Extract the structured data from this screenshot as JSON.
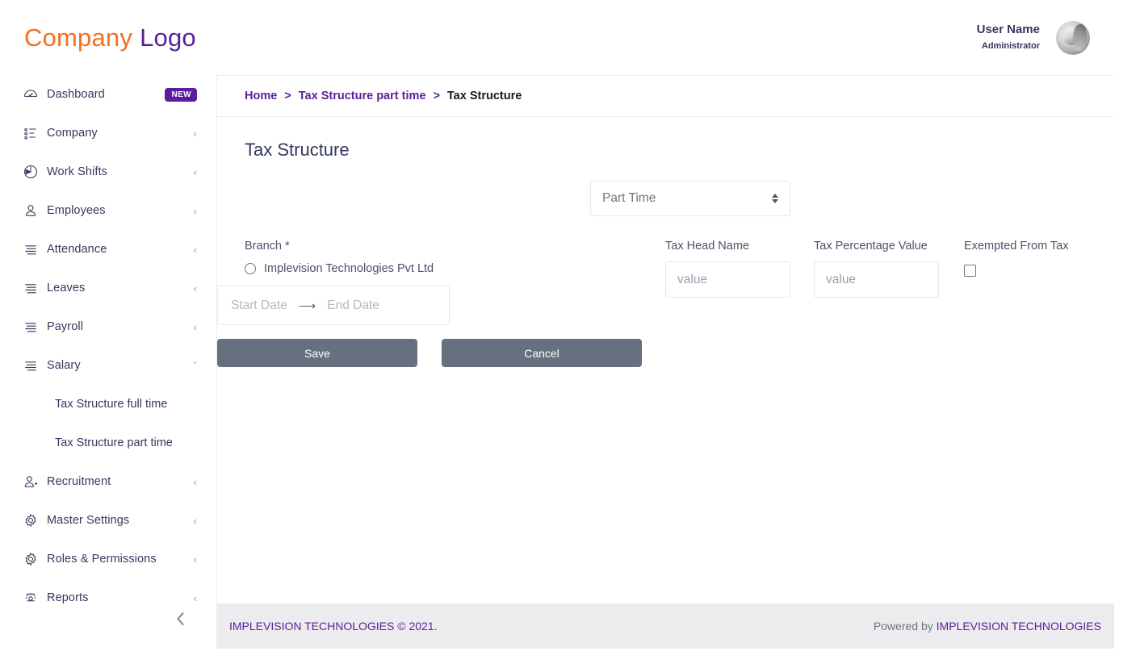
{
  "logo": {
    "first": "Company",
    "second": "Logo"
  },
  "header": {
    "user_name": "User Name",
    "user_role": "Administrator",
    "avatar_icon": "user-avatar-photo"
  },
  "sidebar": {
    "items": [
      {
        "label": "Dashboard",
        "icon": "dashboard-gauge-icon",
        "badge": "NEW",
        "chevron": ""
      },
      {
        "label": "Company",
        "icon": "list-bullets-icon",
        "badge": "",
        "chevron": "‹"
      },
      {
        "label": "Work Shifts",
        "icon": "clock-pie-icon",
        "badge": "",
        "chevron": "‹"
      },
      {
        "label": "Employees",
        "icon": "person-icon",
        "badge": "",
        "chevron": "‹"
      },
      {
        "label": "Attendance",
        "icon": "lines-icon",
        "badge": "",
        "chevron": "‹"
      },
      {
        "label": "Leaves",
        "icon": "lines-icon",
        "badge": "",
        "chevron": "‹"
      },
      {
        "label": "Payroll",
        "icon": "lines-icon",
        "badge": "",
        "chevron": "‹"
      },
      {
        "label": "Salary",
        "icon": "lines-icon",
        "badge": "",
        "chevron": "ˇ"
      }
    ],
    "sub_items": [
      {
        "label": "Tax Structure full time"
      },
      {
        "label": "Tax Structure part time"
      }
    ],
    "items_after": [
      {
        "label": "Recruitment",
        "icon": "person-add-icon",
        "badge": "",
        "chevron": "‹"
      },
      {
        "label": "Master Settings",
        "icon": "gear-icon",
        "badge": "",
        "chevron": "‹"
      },
      {
        "label": "Roles & Permissions",
        "icon": "gear-icon",
        "badge": "",
        "chevron": "‹"
      },
      {
        "label": "Reports",
        "icon": "report-gear-icon",
        "badge": "",
        "chevron": "‹"
      }
    ],
    "collapse_icon": "chevron-left-icon"
  },
  "breadcrumb": {
    "home": "Home",
    "sep1": ">",
    "parent": "Tax Structure part time",
    "sep2": ">",
    "current": "Tax Structure"
  },
  "main": {
    "page_title": "Tax Structure",
    "type_select": {
      "value": "Part Time"
    },
    "branch": {
      "label": "Branch *",
      "option_label": "Implevision Technologies Pvt Ltd"
    },
    "date_range": {
      "start_placeholder": "Start Date",
      "arrow": "⟶",
      "end_placeholder": "End Date"
    },
    "tax_head": {
      "label": "Tax Head Name",
      "placeholder": "value"
    },
    "tax_percentage": {
      "label": "Tax Percentage Value",
      "placeholder": "value"
    },
    "exempted": {
      "label": "Exempted From Tax"
    },
    "save_label": "Save",
    "cancel_label": "Cancel"
  },
  "footer": {
    "left": "IMPLEVISION TECHNOLOGIES © 2021.",
    "powered_by": "Powered by ",
    "brand": "IMPLEVISION TECHNOLOGIES"
  },
  "colors": {
    "logo_orange": "#f4701f",
    "purple": "#5b1d9b",
    "button_gray": "#67707e",
    "text_navy": "#34395e"
  }
}
